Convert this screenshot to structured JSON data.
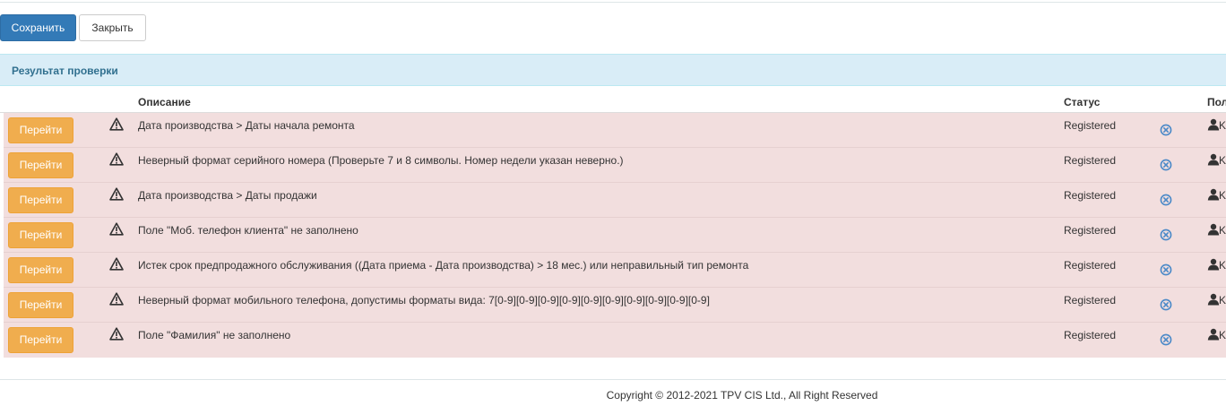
{
  "toolbar": {
    "save_label": "Сохранить",
    "close_label": "Закрыть"
  },
  "panel": {
    "title": "Результат проверки"
  },
  "table": {
    "columns": {
      "description": "Описание",
      "status": "Статус",
      "user": "Пол"
    },
    "go_label": "Перейти",
    "rows": [
      {
        "description": "Дата производства > Даты начала ремонта",
        "status": "Registered",
        "user": "K"
      },
      {
        "description": "Неверный формат серийного номера (Проверьте 7 и 8 символы. Номер недели указан неверно.)",
        "status": "Registered",
        "user": "K"
      },
      {
        "description": "Дата производства > Даты продажи",
        "status": "Registered",
        "user": "K"
      },
      {
        "description": "Поле \"Моб. телефон клиента\" не заполнено",
        "status": "Registered",
        "user": "K"
      },
      {
        "description": "Истек срок предпродажного обслуживания ((Дата приема - Дата производства) > 18 мес.) или неправильный тип ремонта",
        "status": "Registered",
        "user": "K"
      },
      {
        "description": "Неверный формат мобильного телефона, допустимы форматы вида: 7[0-9][0-9][0-9][0-9][0-9][0-9][0-9][0-9][0-9][0-9]",
        "status": "Registered",
        "user": "K"
      },
      {
        "description": "Поле \"Фамилия\" не заполнено",
        "status": "Registered",
        "user": "K"
      }
    ]
  },
  "footer": {
    "copyright": "Copyright © 2012-2021 TPV CIS Ltd., All Right Reserved"
  },
  "colors": {
    "primary": "#337ab7",
    "warning": "#f0ad4e",
    "danger_row": "#f2dede",
    "info_panel": "#d9edf7"
  },
  "icons": {
    "row_warning": "warning-triangle-icon",
    "row_remove": "remove-circle-icon",
    "row_user": "user-icon"
  }
}
